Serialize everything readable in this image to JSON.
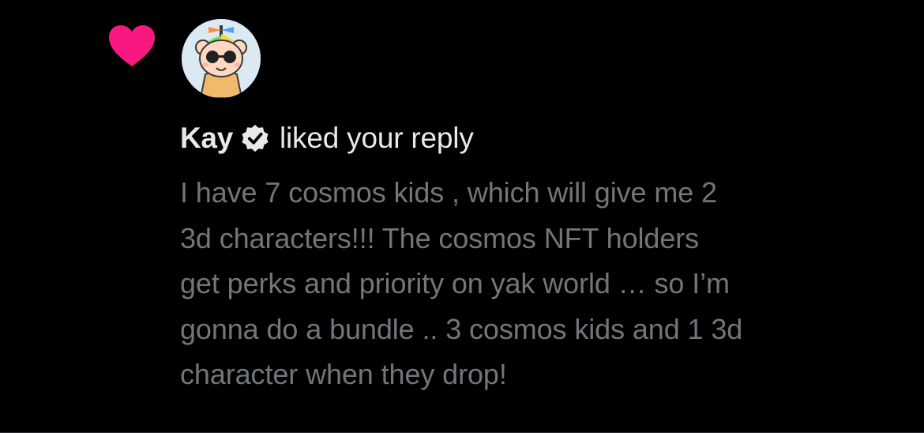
{
  "notification": {
    "type_icon": "heart-icon",
    "avatar_icon": "avatar",
    "user_name": "Kay",
    "verified_icon": "verified-badge-icon",
    "action_text": "liked your reply",
    "reply_text": "I have 7 cosmos kids , which will give me 2\n3d characters!!! The cosmos NFT holders\nget perks and priority on yak world … so I’m\ngonna do a bundle .. 3 cosmos kids and 1 3d\ncharacter when they drop!"
  },
  "colors": {
    "background": "#000000",
    "heart": "#f91880",
    "primary_text": "#e7e9ea",
    "secondary_text": "#71767b"
  }
}
